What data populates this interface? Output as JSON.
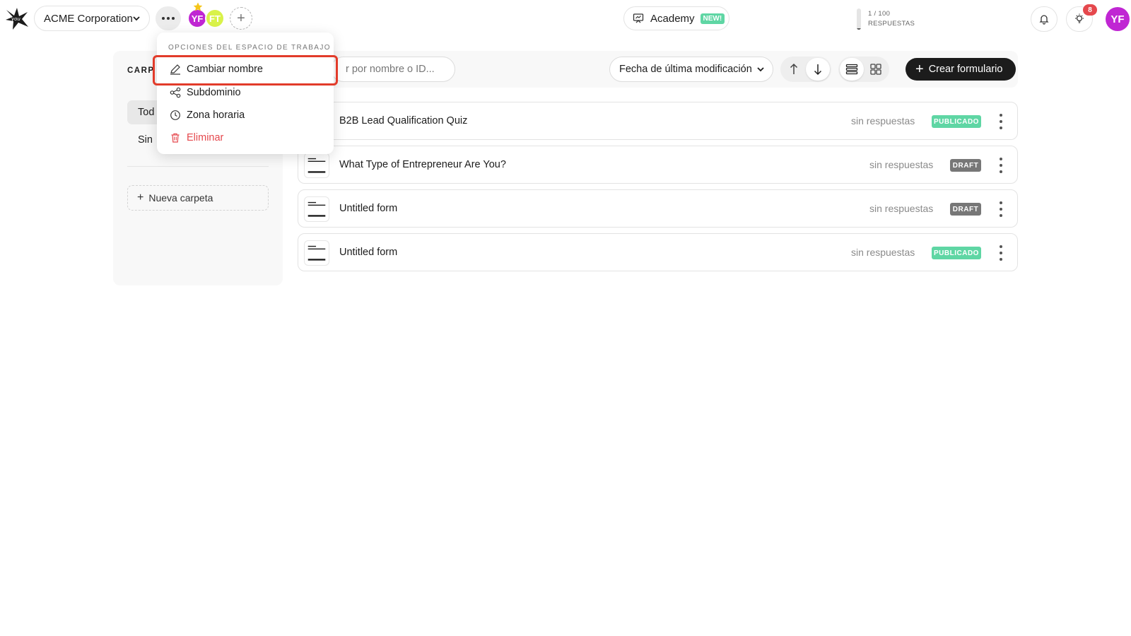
{
  "header": {
    "workspace_name": "ACME Corporation",
    "members": [
      {
        "initials": "YF",
        "color": "#c026d3"
      },
      {
        "initials": "FT",
        "color": "#d9f24a"
      }
    ],
    "add_member_label": "+",
    "academy_label": "Academy",
    "academy_badge": "NEW!",
    "responses_count": "1 / 100",
    "responses_label": "RESPUESTAS",
    "responses_fraction": 0.01,
    "notifications_count": "8",
    "user_initials": "YF",
    "user_color": "#c026d3"
  },
  "workspace_menu": {
    "title": "OPCIONES DEL ESPACIO DE TRABAJO",
    "items": [
      {
        "label": "Cambiar nombre",
        "icon": "pencil-icon",
        "highlighted": true
      },
      {
        "label": "Subdominio",
        "icon": "share-nodes-icon"
      },
      {
        "label": "Zona horaria",
        "icon": "clock-icon"
      },
      {
        "label": "Eliminar",
        "icon": "trash-icon",
        "color": "#e5484d"
      }
    ]
  },
  "folders": {
    "title": "CARP",
    "items": [
      {
        "label": "Tod",
        "active": true
      },
      {
        "label": "Sin",
        "active": false
      }
    ],
    "new_folder_label": "Nueva carpeta"
  },
  "toolbar": {
    "search_placeholder": "r por nombre o ID...",
    "sort_label": "Fecha de última modificación",
    "create_label": "Crear formulario"
  },
  "forms": [
    {
      "name": "B2B Lead Qualification Quiz",
      "responses": "sin respuestas",
      "status": "PUBLICADO"
    },
    {
      "name": "What Type of Entrepreneur Are You?",
      "responses": "sin respuestas",
      "status": "DRAFT"
    },
    {
      "name": "Untitled form",
      "responses": "sin respuestas",
      "status": "DRAFT"
    },
    {
      "name": "Untitled form",
      "responses": "sin respuestas",
      "status": "PUBLICADO"
    }
  ],
  "colors": {
    "accent_dark": "#1c1c1c",
    "published": "#5fd6a4",
    "draft": "#777777",
    "danger": "#e5484d",
    "highlight": "#e23b2a"
  }
}
